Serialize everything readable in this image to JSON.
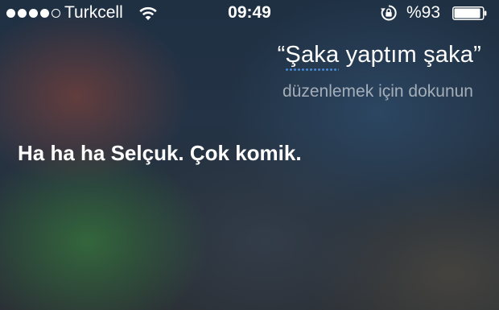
{
  "status_bar": {
    "signal_dots_filled": 4,
    "signal_dots_total": 5,
    "carrier": "Turkcell",
    "time": "09:49",
    "battery_percent": "%93",
    "battery_level": 0.93,
    "icons": [
      "wifi-icon",
      "rotation-lock-icon",
      "battery-icon"
    ]
  },
  "siri": {
    "quote_open": "“",
    "quote_first_word": "Şaka",
    "quote_rest": " yaptım şaka”",
    "edit_hint": "düzenlemek için dokunun",
    "response": "Ha ha ha Selçuk. Çok komik."
  },
  "colors": {
    "text": "#ffffff",
    "hint_text": "#c8cdd4",
    "correction_underline": "#4a90e2"
  }
}
